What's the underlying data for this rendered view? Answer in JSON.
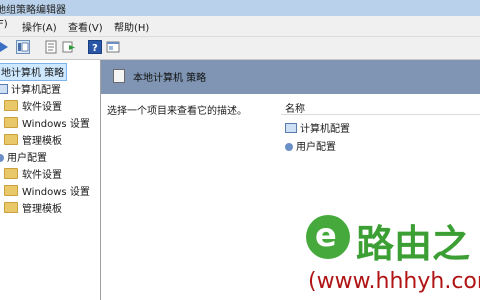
{
  "window": {
    "title": "地组策略编辑器"
  },
  "menu": [
    "F)",
    "操作(A)",
    "查看(V)",
    "帮助(H)"
  ],
  "tree": {
    "root": "地计算机 策略",
    "computer_config": "计算机配置",
    "computer_children": [
      "软件设置",
      "Windows 设置",
      "管理模板"
    ],
    "user_config": "用户配置",
    "user_children": [
      "软件设置",
      "Windows 设置",
      "管理模板"
    ]
  },
  "details": {
    "header_title": "本地计算机 策略",
    "description": "选择一个项目来查看它的描述。",
    "column_name": "名称",
    "items": [
      "计算机配置",
      "用户配置"
    ]
  },
  "watermark": {
    "brand": "路由之",
    "url": "(www.hhhyh.com"
  },
  "colors": {
    "title_bar": "#b9d1ea",
    "details_header": "#7f95b3",
    "brand_green": "#3b9f34",
    "brand_red": "#b01414"
  }
}
